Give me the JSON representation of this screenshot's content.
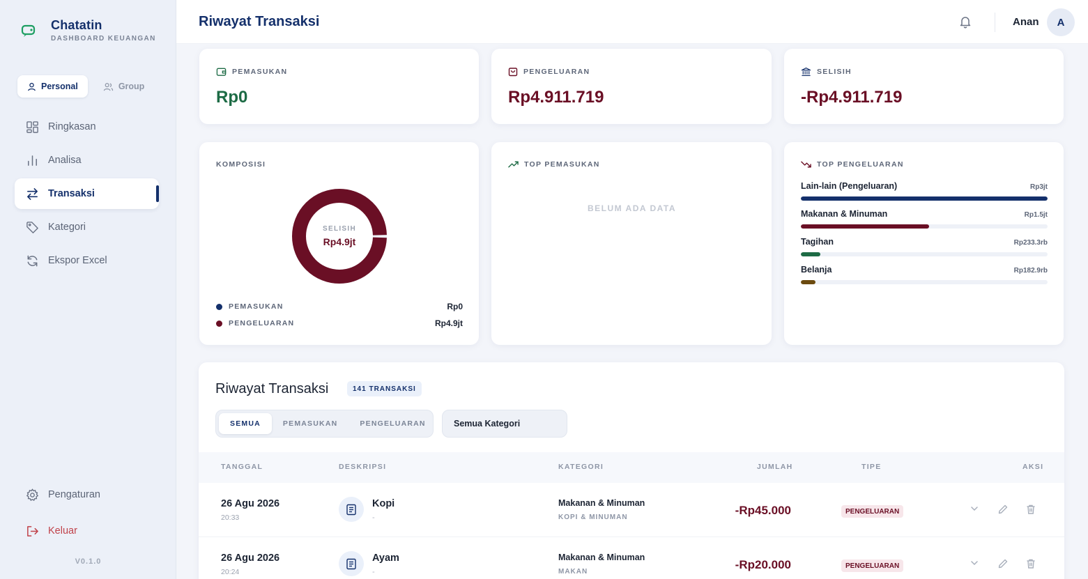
{
  "brand": {
    "title": "Chatatin",
    "subtitle": "DASHBOARD KEUANGAN"
  },
  "mode": {
    "personal": "Personal",
    "group": "Group"
  },
  "nav": {
    "items": [
      {
        "label": "Ringkasan",
        "icon": "grid-icon"
      },
      {
        "label": "Analisa",
        "icon": "bar-chart-icon"
      },
      {
        "label": "Transaksi",
        "icon": "swap-icon",
        "active": true
      },
      {
        "label": "Kategori",
        "icon": "tag-icon"
      },
      {
        "label": "Ekspor Excel",
        "icon": "refresh-icon"
      }
    ],
    "settings": "Pengaturan",
    "logout": "Keluar",
    "version": "V0.1.0"
  },
  "header": {
    "title": "Riwayat Transaksi",
    "user": "Anan",
    "avatar": "A"
  },
  "stats": {
    "income": {
      "label": "PEMASUKAN",
      "value": "Rp0"
    },
    "expense": {
      "label": "PENGELUARAN",
      "value": "Rp4.911.719"
    },
    "diff": {
      "label": "SELISIH",
      "value": "-Rp4.911.719"
    }
  },
  "composition": {
    "label": "KOMPOSISI",
    "center_label": "SELISIH",
    "center_value": "Rp4.9jt",
    "expense_fraction": 1.0,
    "legend": [
      {
        "label": "PEMASUKAN",
        "amount": "Rp0",
        "color": "#14306b"
      },
      {
        "label": "PENGELUARAN",
        "amount": "Rp4.9jt",
        "color": "#6a0f25"
      }
    ]
  },
  "top_income": {
    "label": "TOP PEMASUKAN",
    "empty": "BELUM ADA DATA"
  },
  "top_expense": {
    "label": "TOP PENGELUARAN",
    "items": [
      {
        "name": "Lain-lain (Pengeluaran)",
        "amount": "Rp3jt",
        "fraction": 1.0,
        "color": "#14306b"
      },
      {
        "name": "Makanan & Minuman",
        "amount": "Rp1.5jt",
        "fraction": 0.52,
        "color": "#6a0f25"
      },
      {
        "name": "Tagihan",
        "amount": "Rp233.3rb",
        "fraction": 0.08,
        "color": "#1d6b45"
      },
      {
        "name": "Belanja",
        "amount": "Rp182.9rb",
        "fraction": 0.06,
        "color": "#6b4a0f"
      }
    ]
  },
  "transactions": {
    "title": "Riwayat Transaksi",
    "count_badge": "141 TRANSAKSI",
    "filters": [
      "SEMUA",
      "PEMASUKAN",
      "PENGELUARAN"
    ],
    "category_select": "Semua Kategori",
    "columns": {
      "date": "TANGGAL",
      "desc": "DESKRIPSI",
      "category": "KATEGORI",
      "amount": "JUMLAH",
      "type": "TIPE",
      "action": "AKSI"
    },
    "rows": [
      {
        "date": "26 Agu 2026",
        "time": "20:33",
        "desc": "Kopi",
        "note": "-",
        "category": "Makanan & Minuman",
        "subcategory": "KOPI & MINUMAN",
        "amount": "-Rp45.000",
        "type": "PENGELUARAN"
      },
      {
        "date": "26 Agu 2026",
        "time": "20:24",
        "desc": "Ayam",
        "note": "-",
        "category": "Makanan & Minuman",
        "subcategory": "MAKAN",
        "amount": "-Rp20.000",
        "type": "PENGELUARAN"
      }
    ]
  }
}
